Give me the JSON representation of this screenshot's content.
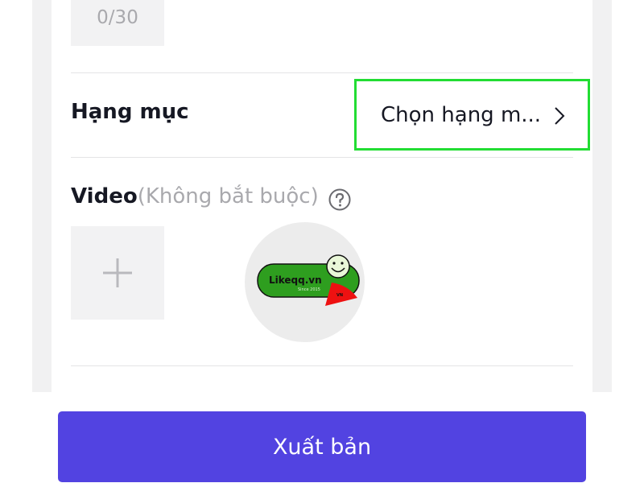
{
  "title_counter": "0/30",
  "category": {
    "label": "Hạng mục",
    "button_text": "Chọn hạng m..."
  },
  "video": {
    "label": "Video",
    "optional": "(Không bắt buộc)"
  },
  "thumbnail": {
    "logo_text": "Likeqq.vn",
    "logo_sub": "Since 2015",
    "logo_tag": "VN"
  },
  "publish_button": "Xuất bản",
  "colors": {
    "primary": "#5243e1",
    "highlight": "#22dd33",
    "text": "#161823",
    "muted": "#a9a9ad"
  },
  "icons": {
    "chevron": "chevron-right-icon",
    "help": "question-circle-icon",
    "add": "plus-icon"
  }
}
